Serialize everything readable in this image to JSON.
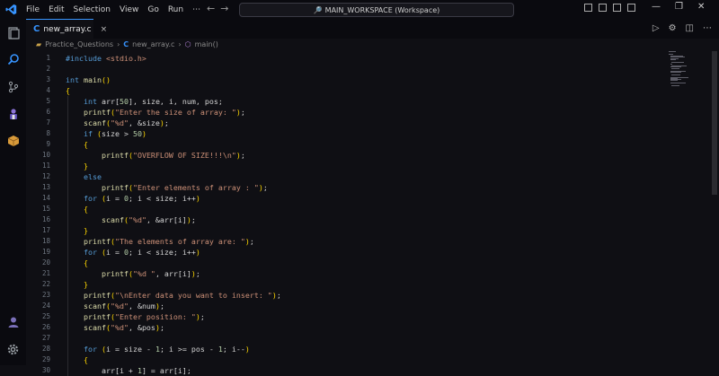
{
  "menu": [
    "File",
    "Edit",
    "Selection",
    "View",
    "Go",
    "Run",
    "⋯"
  ],
  "search": {
    "text": "MAIN_WORKSPACE (Workspace)"
  },
  "tab": {
    "label": "new_array.c",
    "close": "×"
  },
  "breadcrumb": {
    "folder": "Practice_Questions",
    "file": "new_array.c",
    "symbol": "main()",
    "sep": "›"
  },
  "colors": {
    "accent": "#3794ff",
    "keyword": "#569cd6",
    "string": "#ce9178",
    "function": "#dcdcaa",
    "number": "#b5cea8",
    "bracket": "#ffd700"
  },
  "icons": {
    "activity": [
      "explorer-icon",
      "search-icon",
      "source-control-icon",
      "extensions-icon",
      "package-icon",
      "account-icon",
      "settings-gear-icon"
    ],
    "window": [
      "minimize-icon",
      "maximize-icon",
      "close-icon"
    ]
  },
  "code_lines": [
    "#include <stdio.h>",
    "",
    "int main()",
    "{",
    "    int arr[50], size, i, num, pos;",
    "    printf(\"Enter the size of array: \");",
    "    scanf(\"%d\", &size);",
    "    if (size > 50)",
    "    {",
    "        printf(\"OVERFLOW OF SIZE!!!\\n\");",
    "    }",
    "    else",
    "        printf(\"Enter elements of array : \");",
    "    for (i = 0; i < size; i++)",
    "    {",
    "        scanf(\"%d\", &arr[i]);",
    "    }",
    "    printf(\"The elements of array are: \");",
    "    for (i = 0; i < size; i++)",
    "    {",
    "        printf(\"%d \", arr[i]);",
    "    }",
    "    printf(\"\\nEnter data you want to insert: \");",
    "    scanf(\"%d\", &num);",
    "    printf(\"Enter position: \");",
    "    scanf(\"%d\", &pos);",
    "",
    "    for (i = size - 1; i >= pos - 1; i--)",
    "    {",
    "        arr[i + 1] = arr[i];"
  ]
}
